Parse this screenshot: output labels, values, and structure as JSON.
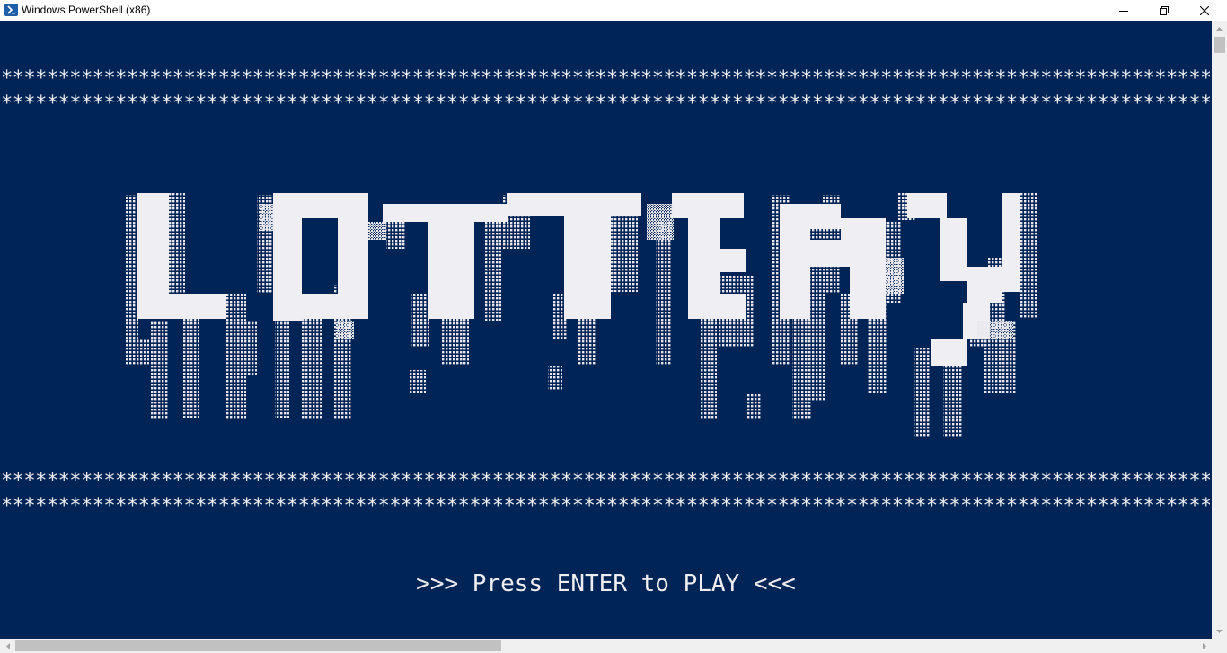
{
  "window": {
    "title": "Windows PowerShell (x86)",
    "icon": "powershell-icon",
    "controls": [
      "minimize-icon",
      "restore-icon",
      "close-icon"
    ]
  },
  "colors": {
    "console_bg": "#012456",
    "console_fg": "#eeedf0",
    "titlebar_bg": "#ffffff"
  },
  "console": {
    "star_lines": [
      "******************************************************************************************************************************************************",
      "******************************************************************************************************************************************************",
      "******************************************************************************************************************************************************",
      "******************************************************************************************************************************************************"
    ],
    "logo_text": "LOTTERY",
    "prompt": ">>> Press ENTER to PLAY <<<"
  }
}
